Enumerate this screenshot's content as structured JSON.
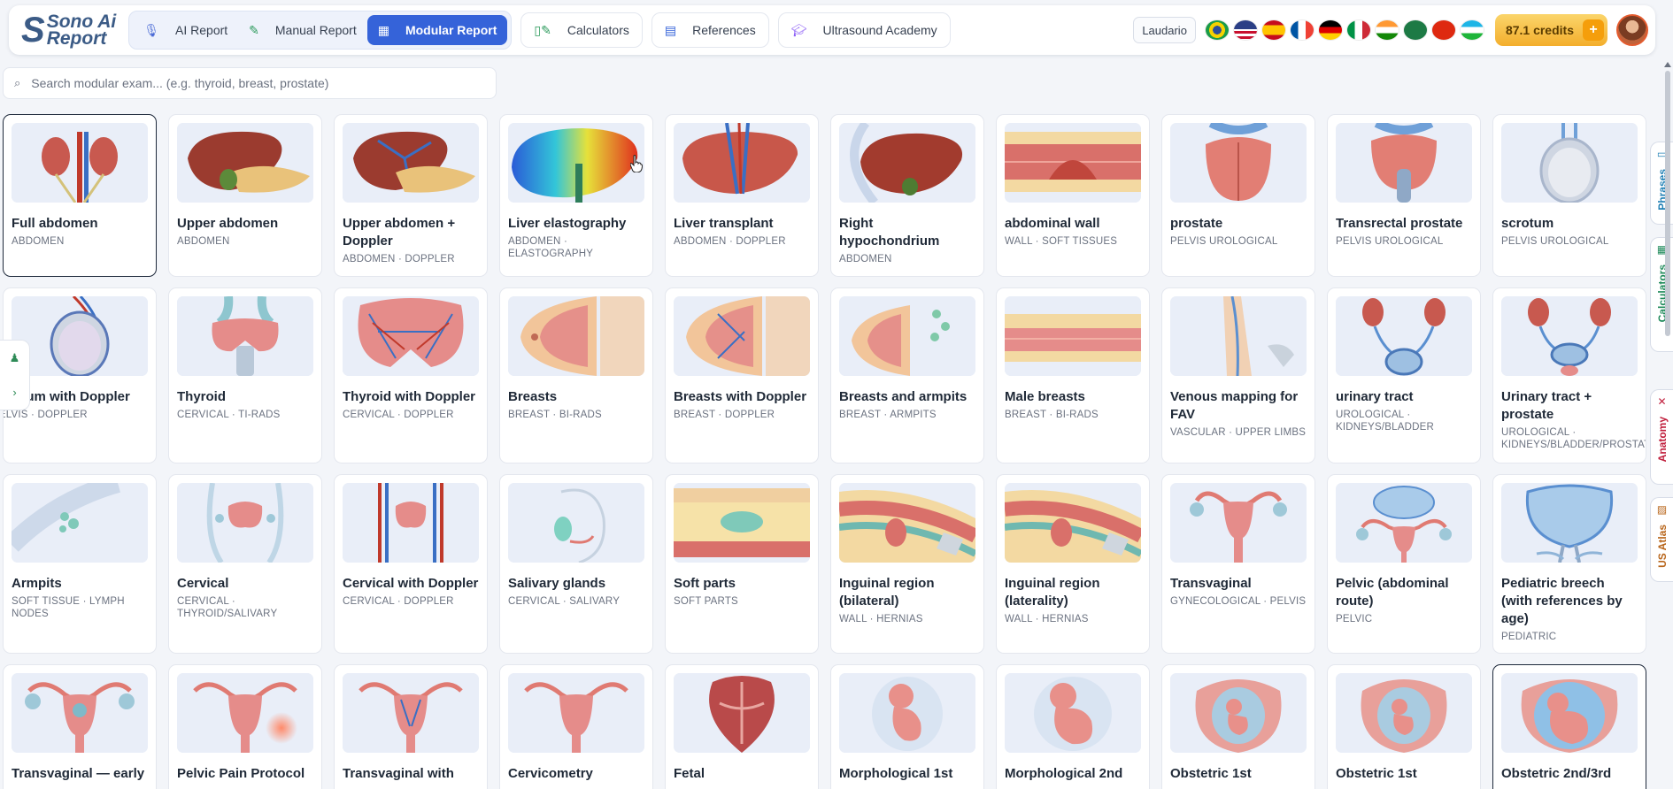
{
  "header": {
    "logo_top": "Sono Ai",
    "logo_bottom": "Report",
    "modes": [
      {
        "label": "AI Report",
        "icon": "microphone-icon"
      },
      {
        "label": "Manual Report",
        "icon": "pencil-icon"
      },
      {
        "label": "Modular Report",
        "icon": "modules-icon",
        "active": true
      }
    ],
    "nav": [
      {
        "label": "Calculators",
        "icon": "calculator-icon"
      },
      {
        "label": "References",
        "icon": "book-icon"
      },
      {
        "label": "Ultrasound Academy",
        "icon": "graduation-cap-icon"
      }
    ],
    "user": "Laudario",
    "credits": "87.1 credits",
    "credits_plus": "+"
  },
  "search": {
    "placeholder": "Search modular exam... (e.g. thyroid, breast, prostate)"
  },
  "side_tabs": [
    "Phrases",
    "Calculators",
    "Anatomy",
    "US Atlas"
  ],
  "colors": {
    "accent": "#3563d9",
    "credits": "#f3ae2c",
    "subtitle": "#6b7280"
  },
  "cards": [
    {
      "title": "Full abdomen",
      "subtitle": "ABDOMEN"
    },
    {
      "title": "Upper abdomen",
      "subtitle": "ABDOMEN"
    },
    {
      "title": "Upper abdomen + Doppler",
      "subtitle": "ABDOMEN · DOPPLER"
    },
    {
      "title": "Liver elastography",
      "subtitle": "ABDOMEN · ELASTOGRAPHY"
    },
    {
      "title": "Liver transplant",
      "subtitle": "ABDOMEN · DOPPLER"
    },
    {
      "title": "Right hypochondrium",
      "subtitle": "ABDOMEN"
    },
    {
      "title": "abdominal wall",
      "subtitle": "WALL · SOFT TISSUES"
    },
    {
      "title": "prostate",
      "subtitle": "PELVIS UROLOGICAL"
    },
    {
      "title": "Transrectal prostate",
      "subtitle": "PELVIS UROLOGICAL"
    },
    {
      "title": "scrotum",
      "subtitle": "PELVIS UROLOGICAL"
    },
    {
      "title": "Scrotum with Doppler",
      "subtitle": "PELVIS · DOPPLER"
    },
    {
      "title": "Thyroid",
      "subtitle": "CERVICAL · TI-RADS"
    },
    {
      "title": "Thyroid with Doppler",
      "subtitle": "CERVICAL · DOPPLER"
    },
    {
      "title": "Breasts",
      "subtitle": "BREAST · BI-RADS"
    },
    {
      "title": "Breasts with Doppler",
      "subtitle": "BREAST · DOPPLER"
    },
    {
      "title": "Breasts and armpits",
      "subtitle": "BREAST · ARMPITS"
    },
    {
      "title": "Male breasts",
      "subtitle": "BREAST · BI-RADS"
    },
    {
      "title": "Venous mapping for FAV",
      "subtitle": "VASCULAR · UPPER LIMBS"
    },
    {
      "title": "urinary tract",
      "subtitle": "UROLOGICAL · KIDNEYS/BLADDER"
    },
    {
      "title": "Urinary tract + prostate",
      "subtitle": "UROLOGICAL · KIDNEYS/BLADDER/PROSTATE"
    },
    {
      "title": "Armpits",
      "subtitle": "SOFT TISSUE · LYMPH NODES"
    },
    {
      "title": "Cervical",
      "subtitle": "CERVICAL · THYROID/SALIVARY"
    },
    {
      "title": "Cervical with Doppler",
      "subtitle": "CERVICAL · DOPPLER"
    },
    {
      "title": "Salivary glands",
      "subtitle": "CERVICAL · SALIVARY"
    },
    {
      "title": "Soft parts",
      "subtitle": "SOFT PARTS"
    },
    {
      "title": "Inguinal region (bilateral)",
      "subtitle": "WALL · HERNIAS"
    },
    {
      "title": "Inguinal region (laterality)",
      "subtitle": "WALL · HERNIAS"
    },
    {
      "title": "Transvaginal",
      "subtitle": "GYNECOLOGICAL · PELVIS"
    },
    {
      "title": "Pelvic (abdominal route)",
      "subtitle": "PELVIC"
    },
    {
      "title": "Pediatric breech (with references by age)",
      "subtitle": "PEDIATRIC"
    },
    {
      "title": "Transvaginal — early",
      "subtitle": ""
    },
    {
      "title": "Pelvic Pain Protocol",
      "subtitle": ""
    },
    {
      "title": "Transvaginal with",
      "subtitle": ""
    },
    {
      "title": "Cervicometry",
      "subtitle": ""
    },
    {
      "title": "Fetal",
      "subtitle": ""
    },
    {
      "title": "Morphological 1st",
      "subtitle": ""
    },
    {
      "title": "Morphological 2nd",
      "subtitle": ""
    },
    {
      "title": "Obstetric 1st",
      "subtitle": ""
    },
    {
      "title": "Obstetric 1st",
      "subtitle": ""
    },
    {
      "title": "Obstetric 2nd/3rd",
      "subtitle": ""
    }
  ]
}
